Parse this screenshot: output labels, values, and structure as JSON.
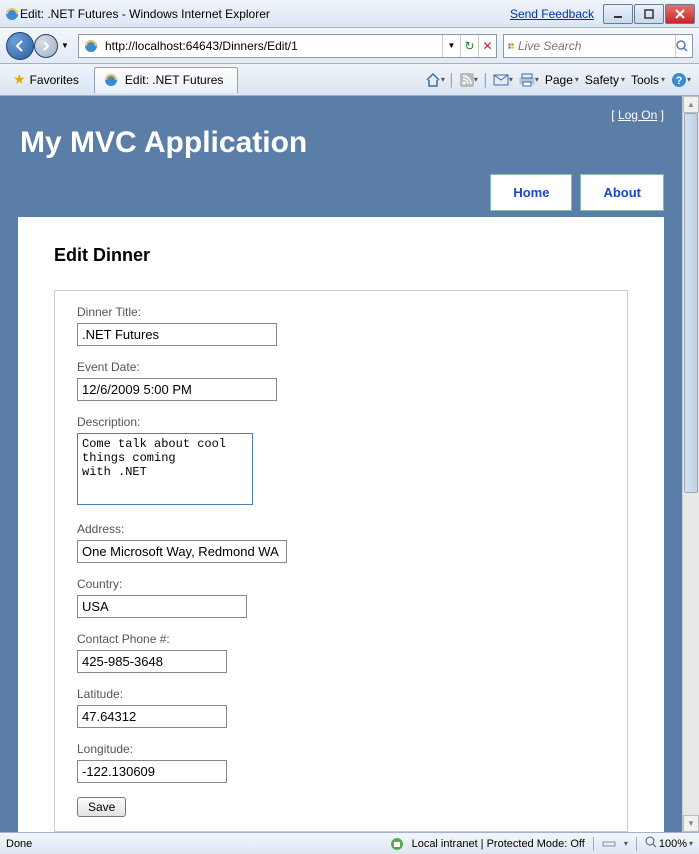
{
  "window": {
    "title": "Edit: .NET Futures - Windows Internet Explorer",
    "send_feedback": "Send Feedback"
  },
  "nav": {
    "url": "http://localhost:64643/Dinners/Edit/1",
    "search_placeholder": "Live Search"
  },
  "cmdbar": {
    "favorites": "Favorites",
    "tab_label": "Edit: .NET Futures",
    "page": "Page",
    "safety": "Safety",
    "tools": "Tools"
  },
  "app": {
    "logon_prefix": "[ ",
    "logon_link": "Log On",
    "logon_suffix": " ]",
    "title": "My MVC Application",
    "menu": {
      "home": "Home",
      "about": "About"
    }
  },
  "form": {
    "heading": "Edit Dinner",
    "labels": {
      "title": "Dinner Title:",
      "eventdate": "Event Date:",
      "description": "Description:",
      "address": "Address:",
      "country": "Country:",
      "phone": "Contact Phone #:",
      "latitude": "Latitude:",
      "longitude": "Longitude:"
    },
    "values": {
      "title": ".NET Futures",
      "eventdate": "12/6/2009 5:00 PM",
      "description": "Come talk about cool things coming\nwith .NET",
      "address": "One Microsoft Way, Redmond WA",
      "country": "USA",
      "phone": "425-985-3648",
      "latitude": "47.64312",
      "longitude": "-122.130609"
    },
    "save": "Save"
  },
  "status": {
    "done": "Done",
    "zone": "Local intranet | Protected Mode: Off",
    "zoom": "100%"
  }
}
